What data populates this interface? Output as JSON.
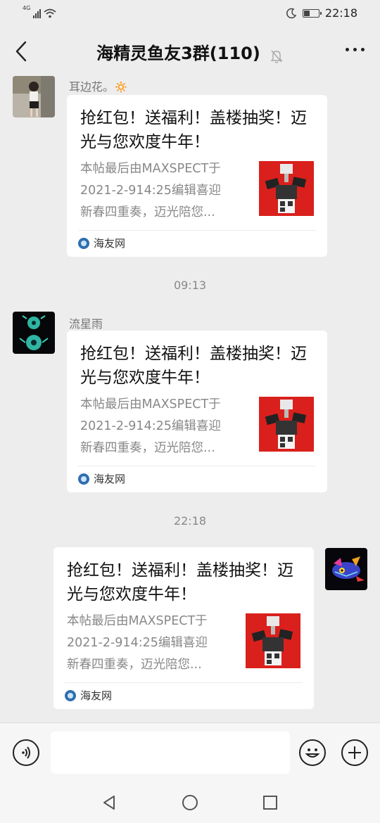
{
  "status_bar": {
    "network": "4G",
    "time": "22:18",
    "battery_level": 0.45
  },
  "header": {
    "back_icon": "chevron-left-icon",
    "title": "海精灵鱼友3群(110)",
    "muted_icon": "bell-off-icon",
    "more_icon": "more-dots-icon"
  },
  "messages": [
    {
      "sender": "耳边花。🔅",
      "card": {
        "title": "抢红包！送福利！盖楼抽奖！迈光与您欢度牛年！",
        "desc_lines": [
          "本帖最后由MAXSPECT于",
          "2021-2-914:25编辑喜迎",
          "新春四重奏，迈光陪您..."
        ],
        "source": "海友网"
      }
    },
    {
      "sender": "流星雨",
      "card": {
        "title": "抢红包！送福利！盖楼抽奖！迈光与您欢度牛年！",
        "desc_lines": [
          "本帖最后由MAXSPECT于",
          "2021-2-914:25编辑喜迎",
          "新春四重奏，迈光陪您..."
        ],
        "source": "海友网"
      }
    },
    {
      "sender": "",
      "card": {
        "title": "抢红包！送福利！盖楼抽奖！迈光与您欢度牛年！",
        "desc_lines": [
          "本帖最后由MAXSPECT于",
          "2021-2-914:25编辑喜迎",
          "新春四重奏，迈光陪您..."
        ],
        "source": "海友网"
      }
    }
  ],
  "timestamps": [
    "09:13",
    "22:18"
  ],
  "input_bar": {
    "voice_icon": "voice-icon",
    "emoji_icon": "emoji-icon",
    "plus_icon": "plus-icon",
    "placeholder": ""
  },
  "system_nav": {
    "back": "triangle-back-icon",
    "home": "circle-home-icon",
    "recent": "square-recent-icon"
  },
  "colors": {
    "background": "#ededed",
    "card": "#ffffff",
    "source_icon": "#2f6fb0",
    "thumb_red": "#d9201c"
  }
}
